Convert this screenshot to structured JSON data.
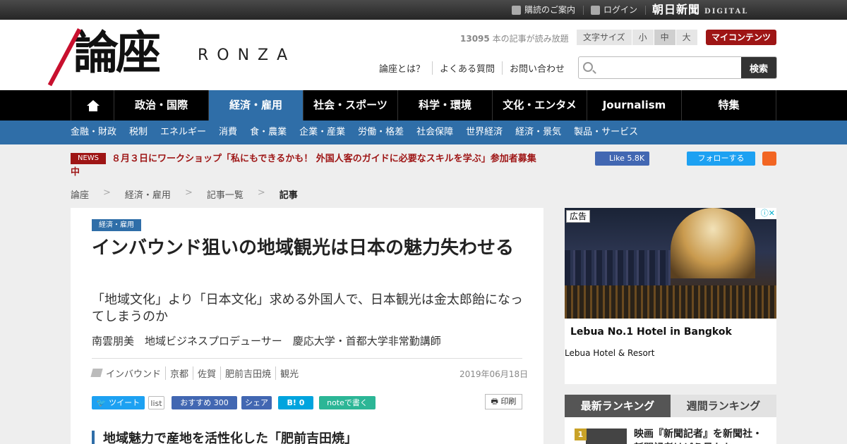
{
  "topbar": {
    "guide": "購読のご案内",
    "login": "ログイン",
    "brand": "朝日新聞",
    "brand_sub": "DIGITAL"
  },
  "header": {
    "logo_kanji": "論座",
    "logo_roman": "RONZA",
    "article_count": "13095",
    "article_count_suffix": " 本の記事が読み放題",
    "font_size_label": "文字サイズ",
    "font_sizes": [
      "小",
      "中",
      "大"
    ],
    "font_size_selected": "中",
    "my_content": "マイコンテンツ",
    "links": [
      "論座とは？",
      "よくある質問",
      "お問い合わせ"
    ],
    "search_placeholder": "",
    "search_button": "検索"
  },
  "nav": {
    "items": [
      "政治・国際",
      "経済・雇用",
      "社会・スポーツ",
      "科学・環境",
      "文化・エンタメ",
      "Journalism",
      "特集"
    ],
    "active": "経済・雇用"
  },
  "subnav": [
    "金融・財政",
    "税制",
    "エネルギー",
    "消費",
    "食・農業",
    "企業・産業",
    "労働・格差",
    "社会保障",
    "世界経済",
    "経済・景気",
    "製品・サービス"
  ],
  "news": {
    "tag": "NEWS",
    "text": "８月３日にワークショップ「私にもできるかも！ 外国人客のガイドに必要なスキルを学ぶ」参加者募集中"
  },
  "social": {
    "fb_label": "Like",
    "fb_count": "5.8K",
    "twitter_follow": "フォローする"
  },
  "breadcrumb": [
    "論座",
    "経済・雇用",
    "記事一覧",
    "記事"
  ],
  "article": {
    "category": "経済・雇用",
    "title": "インバウンド狙いの地域観光は日本の魅力失わせる",
    "subtitle": "「地域文化」より「日本文化」求める外国人で、日本観光は金太郎飴になってしまうのか",
    "author": "南雲朋美　地域ビジネスプロデューサー　慶応大学・首都大学非常勤講師",
    "tags": [
      "インバウンド",
      "京都",
      "佐賀",
      "肥前吉田焼",
      "観光"
    ],
    "date": "2019年06月18日",
    "share": {
      "tweet": "ツイート",
      "list": "list",
      "fb_recommend": "おすすめ",
      "fb_count": "300",
      "fb_share": "シェア",
      "hatena": "B!",
      "hatena_count": "0",
      "note": "noteで書く",
      "print": "印刷"
    },
    "section_heading": "地域魅力で産地を活性化した「肥前吉田焼」"
  },
  "ad": {
    "label": "広告",
    "headline": "Lebua No.1 Hotel in Bangkok",
    "advertiser": "Lebua Hotel & Resort"
  },
  "ranking": {
    "tab_latest": "最新ランキング",
    "tab_weekly": "週間ランキング",
    "first_rank": "1",
    "first_title": "映画『新聞記者』を新聞社・新聞記者はどう見たか"
  },
  "colors": {
    "accent_blue": "#2f6ea8",
    "brand_red": "#9e1515",
    "nav_black": "#000000"
  }
}
